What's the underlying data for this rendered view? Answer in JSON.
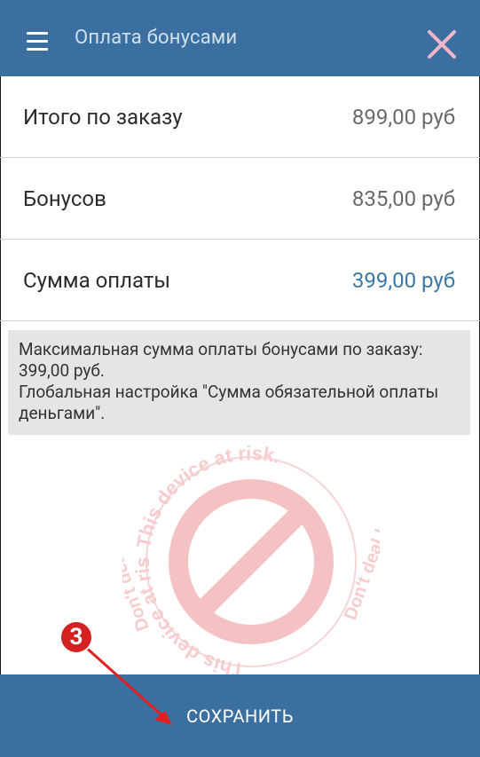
{
  "header": {
    "title": "Оплата бонусами",
    "menu_icon": "hamburger-menu-icon",
    "close_icon": "close-icon"
  },
  "rows": [
    {
      "label": "Итого по заказу",
      "value": "899,00 руб"
    },
    {
      "label": "Бонусов",
      "value": "835,00 руб"
    },
    {
      "label": "Сумма оплаты",
      "value": "399,00 руб"
    }
  ],
  "note": {
    "line1": "Максимальная сумма оплаты бонусами по заказу: 399,00 руб.",
    "line2": "Глобальная настройка \"Сумма обязательной оплаты деньгами\"."
  },
  "watermark": {
    "top": "This device at risk.",
    "right": "Don't deal !",
    "bottom": "This device at risk.",
    "left": "Don't deal !"
  },
  "footer": {
    "save_label": "СОХРАНИТЬ"
  },
  "annotation": {
    "step_number": "3"
  },
  "colors": {
    "brand": "#3b6f9f",
    "accent_value": "#3b78a6",
    "close": "#f2b6c8",
    "badge": "#d32222"
  }
}
